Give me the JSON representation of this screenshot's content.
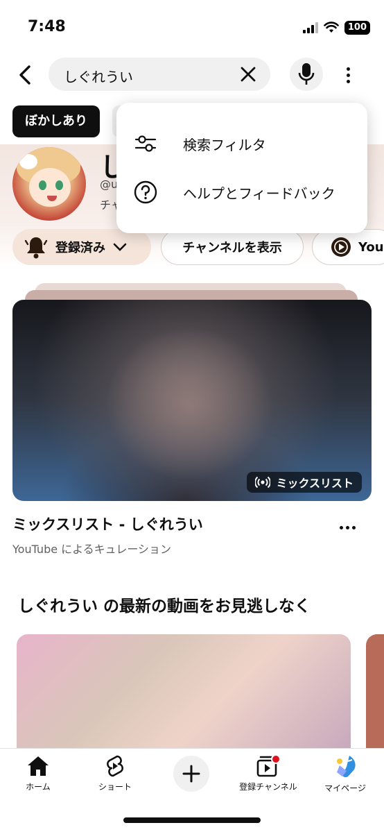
{
  "status_bar": {
    "time": "7:48",
    "battery": "100"
  },
  "search": {
    "query": "しぐれうい"
  },
  "filter_chip": {
    "label": "ぼかしあり"
  },
  "dropdown_menu": {
    "items": [
      {
        "label": "検索フィルタ",
        "icon": "sliders-icon"
      },
      {
        "label": "ヘルプとフィードバック",
        "icon": "help-icon"
      }
    ]
  },
  "channel": {
    "name_partial": "し",
    "handle_partial": "@u",
    "sub_partial": "チャ",
    "subscribed_label": "登録済み",
    "view_channel_label": "チャンネルを表示",
    "youtube_label_partial": "You"
  },
  "mix": {
    "badge": "ミックスリスト",
    "title": "ミックスリスト - しぐれうい",
    "subtitle": "YouTube によるキュレーション"
  },
  "section": {
    "title": "しぐれうい の最新の動画をお見逃しなく"
  },
  "bottom_nav": {
    "home": "ホーム",
    "shorts": "ショート",
    "subscriptions": "登録チャンネル",
    "you": "マイページ"
  },
  "colors": {
    "accent": "#0f0f0f",
    "notification": "#e0101f",
    "subscribed_bg": "#f4e4da"
  }
}
